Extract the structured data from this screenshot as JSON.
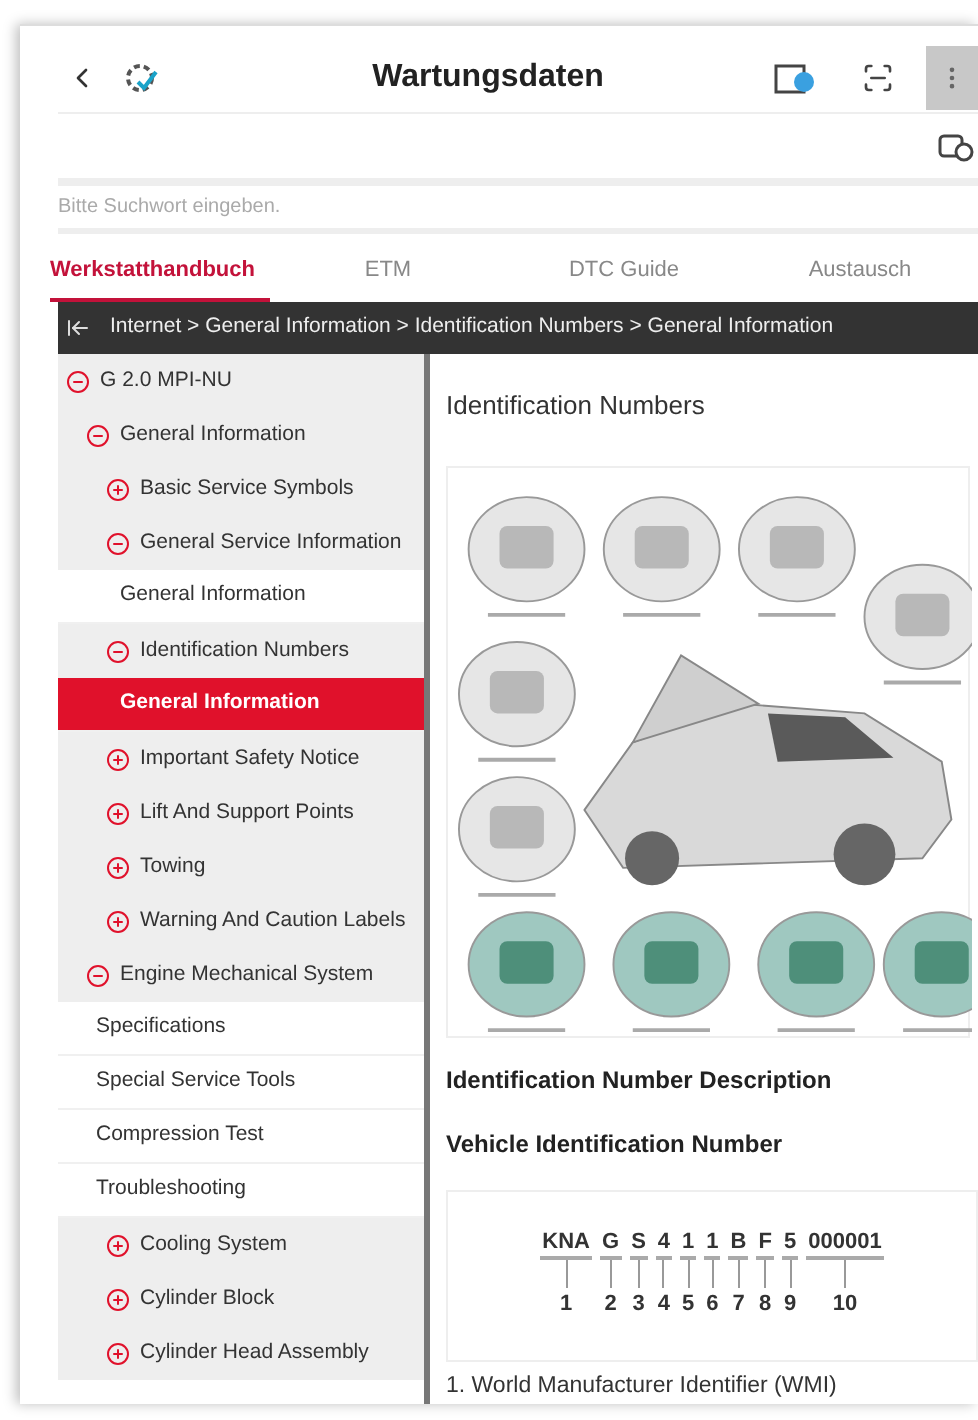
{
  "header": {
    "title": "Wartungsdaten"
  },
  "search": {
    "placeholder": "Bitte Suchwort eingeben."
  },
  "tabs": [
    {
      "label": "Werkstatthandbuch",
      "selected": true
    },
    {
      "label": "ETM",
      "selected": false
    },
    {
      "label": "DTC Guide",
      "selected": false
    },
    {
      "label": "Austausch",
      "selected": false
    }
  ],
  "breadcrumb": "Internet > General Information > Identification Numbers > General Information",
  "sidebar": {
    "items": [
      {
        "kind": "group",
        "label": "G 2.0 MPI-NU",
        "expanded": true,
        "children": [
          {
            "kind": "group",
            "label": "General Information",
            "expanded": true,
            "children": [
              {
                "kind": "group",
                "label": "Basic Service Symbols",
                "expanded": false
              },
              {
                "kind": "group",
                "label": "General Service Information",
                "expanded": true,
                "children": [
                  {
                    "kind": "page",
                    "label": "General Information",
                    "selected": false
                  }
                ]
              },
              {
                "kind": "group",
                "label": "Identification Numbers",
                "expanded": true,
                "children": [
                  {
                    "kind": "page",
                    "label": "General Information",
                    "selected": true
                  }
                ]
              },
              {
                "kind": "group",
                "label": "Important Safety Notice",
                "expanded": false
              },
              {
                "kind": "group",
                "label": "Lift And Support Points",
                "expanded": false
              },
              {
                "kind": "group",
                "label": "Towing",
                "expanded": false
              },
              {
                "kind": "group",
                "label": "Warning And Caution Labels",
                "expanded": false
              }
            ]
          },
          {
            "kind": "group",
            "label": "Engine Mechanical System",
            "expanded": true,
            "children": [
              {
                "kind": "page",
                "label": "Specifications",
                "selected": false
              },
              {
                "kind": "page",
                "label": "Special Service Tools",
                "selected": false
              },
              {
                "kind": "page",
                "label": "Compression Test",
                "selected": false
              },
              {
                "kind": "page",
                "label": "Troubleshooting",
                "selected": false
              },
              {
                "kind": "group",
                "label": "Cooling System",
                "expanded": false
              },
              {
                "kind": "group",
                "label": "Cylinder Block",
                "expanded": false
              },
              {
                "kind": "group",
                "label": "Cylinder Head Assembly",
                "expanded": false
              }
            ]
          }
        ]
      }
    ]
  },
  "content": {
    "heading": "Identification Numbers",
    "section_title": "Identification Number Description",
    "subsection_title": "Vehicle Identification Number",
    "vin": [
      {
        "code": "KNA",
        "number": "1"
      },
      {
        "code": "G",
        "number": "2"
      },
      {
        "code": "S",
        "number": "3"
      },
      {
        "code": "4",
        "number": "4"
      },
      {
        "code": "1",
        "number": "5"
      },
      {
        "code": "1",
        "number": "6"
      },
      {
        "code": "B",
        "number": "7"
      },
      {
        "code": "F",
        "number": "8"
      },
      {
        "code": "5",
        "number": "9"
      },
      {
        "code": "000001",
        "number": "10"
      }
    ],
    "list_item": "1. World Manufacturer Identifier (WMI)"
  }
}
